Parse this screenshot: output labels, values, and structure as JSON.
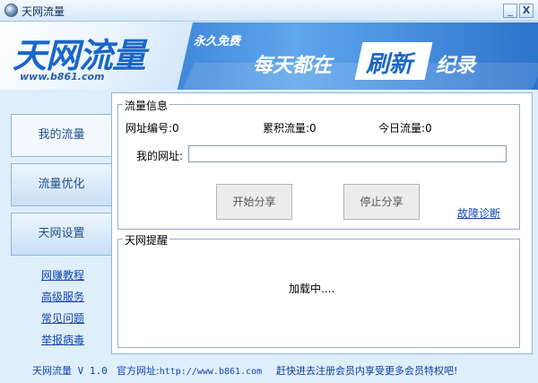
{
  "window": {
    "title": "天网流量",
    "minimize": "_",
    "close": "X"
  },
  "banner": {
    "logo": "天网流量",
    "url": "www.b861.com",
    "free": "永久免费",
    "slogan_start": "每天都在",
    "slogan_highlight": "刷新",
    "slogan_end": "纪录",
    "brand_color": "#1a66c9"
  },
  "nav": {
    "items": [
      {
        "label": "我的流量"
      },
      {
        "label": "流量优化"
      },
      {
        "label": "天网设置"
      }
    ]
  },
  "side_links": [
    {
      "label": "网赚教程"
    },
    {
      "label": "高级服务"
    },
    {
      "label": "常见问题"
    },
    {
      "label": "举报病毒"
    }
  ],
  "traffic_info": {
    "legend": "流量信息",
    "site_id": "网址编号:0",
    "total_traffic": "累积流量:0",
    "today_traffic": "今日流量:0",
    "my_url_label": "我的网址:",
    "my_url_value": "",
    "start_share": "开始分享",
    "stop_share": "停止分享",
    "diagnose": "故障诊断"
  },
  "reminder": {
    "legend": "天网提醒",
    "loading": "加载中...."
  },
  "footer": {
    "version": "天网流量 V 1.0",
    "site_label": "官方网址:",
    "site_url": "http://www.b861.com",
    "promo": "赶快进去注册会员内享受更多会员特权吧!"
  }
}
